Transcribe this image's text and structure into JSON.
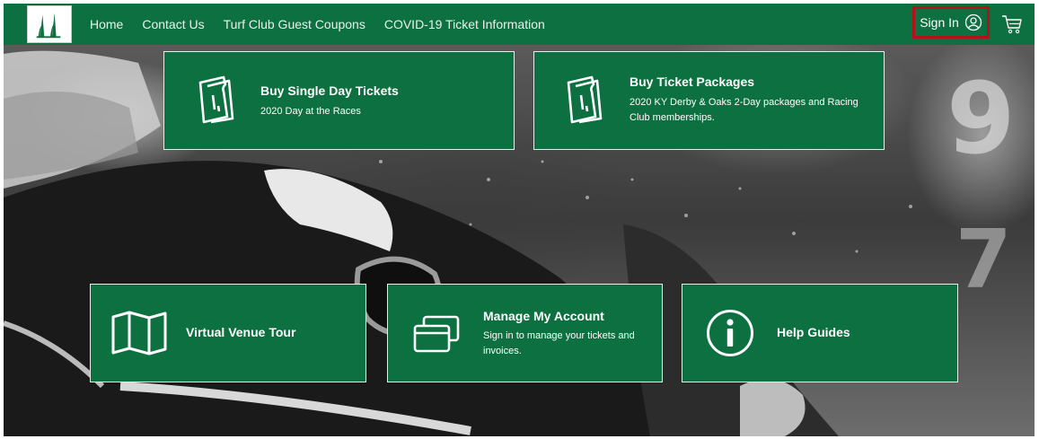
{
  "nav": {
    "logo_alt": "",
    "links": [
      "Home",
      "Contact Us",
      "Turf Club Guest Coupons",
      "COVID-19 Ticket Information"
    ],
    "sign_in": "Sign In",
    "icons": {
      "account": "user-circle-icon",
      "cart": "shopping-cart-icon"
    },
    "highlight_color": "#b3121a"
  },
  "colors": {
    "brand_green": "#0d7040",
    "nav_text": "#e9f2ec",
    "tile_border": "#e6eee9"
  },
  "tiles": {
    "single_day": {
      "title": "Buy Single Day Tickets",
      "subtitle": "2020 Day at the Races",
      "icon": "ticket-icon"
    },
    "packages": {
      "title": "Buy Ticket Packages",
      "subtitle": "2020 KY Derby & Oaks 2-Day packages and Racing Club memberships.",
      "icon": "ticket-icon"
    },
    "tour": {
      "title": "Virtual Venue Tour",
      "icon": "map-icon"
    },
    "account": {
      "title": "Manage My Account",
      "subtitle": "Sign in to manage your tickets and invoices.",
      "icon": "cards-icon"
    },
    "help": {
      "title": "Help Guides",
      "icon": "info-icon"
    }
  }
}
